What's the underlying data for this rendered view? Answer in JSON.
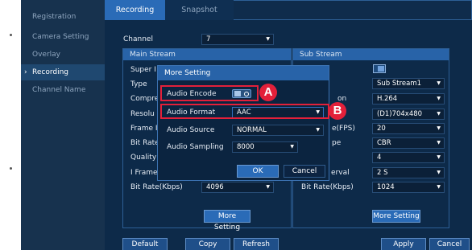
{
  "sidebar": {
    "items": [
      {
        "label": "Registration"
      },
      {
        "label": "Camera Setting"
      },
      {
        "label": "Overlay"
      },
      {
        "label": "Recording",
        "active": true
      },
      {
        "label": "Channel Name"
      }
    ]
  },
  "tabs": [
    {
      "label": "Recording",
      "active": true
    },
    {
      "label": "Snapshot",
      "active": false
    }
  ],
  "channel": {
    "label": "Channel",
    "value": "7"
  },
  "main_stream": {
    "title": "Main Stream",
    "rows": [
      {
        "label": "Super I"
      },
      {
        "label": "Type"
      },
      {
        "label": "Compre"
      },
      {
        "label": "Resolu"
      },
      {
        "label": "Frame I"
      },
      {
        "label": "Bit Rate"
      },
      {
        "label": "Quality"
      },
      {
        "label": "I Frame"
      }
    ],
    "bitrate_label": "Bit Rate(Kbps)",
    "bitrate_value": "4096",
    "more_label": "More Setting"
  },
  "sub_stream": {
    "title": "Sub Stream",
    "type_value": "Sub Stream1",
    "compression_label_frag": "on",
    "compression_value": "H.264",
    "resolution_value": "(D1)704x480",
    "framerate_label_frag": "e(FPS)",
    "framerate_value": "20",
    "bitrate_type_label_frag": "pe",
    "bitrate_type_value": "CBR",
    "quality_value": "4",
    "iframe_label_frag": "erval",
    "iframe_value": "2 S",
    "bitrate_label": "Bit Rate(Kbps)",
    "bitrate_value": "1024",
    "more_label": "More Setting"
  },
  "modal": {
    "title": "More Setting",
    "audio_encode_label": "Audio Encode",
    "audio_format_label": "Audio Format",
    "audio_format_value": "AAC",
    "audio_source_label": "Audio Source",
    "audio_source_value": "NORMAL",
    "audio_sampling_label": "Audio Sampling",
    "audio_sampling_value": "8000",
    "ok_label": "OK",
    "cancel_label": "Cancel"
  },
  "callouts": {
    "a": "A",
    "b": "B"
  },
  "footer": {
    "default_label": "Default",
    "copy_label": "Copy",
    "refresh_label": "Refresh",
    "apply_label": "Apply",
    "cancel_label": "Cancel"
  },
  "colors": {
    "sidebar_bg": "#17324e",
    "main_bg": "#0d2a49",
    "accent": "#2a6bb7",
    "callout_red": "#e3203a"
  },
  "icons": {
    "sidebar_active": "chevron-right-icon",
    "dropdown": "triangle-down-icon"
  }
}
